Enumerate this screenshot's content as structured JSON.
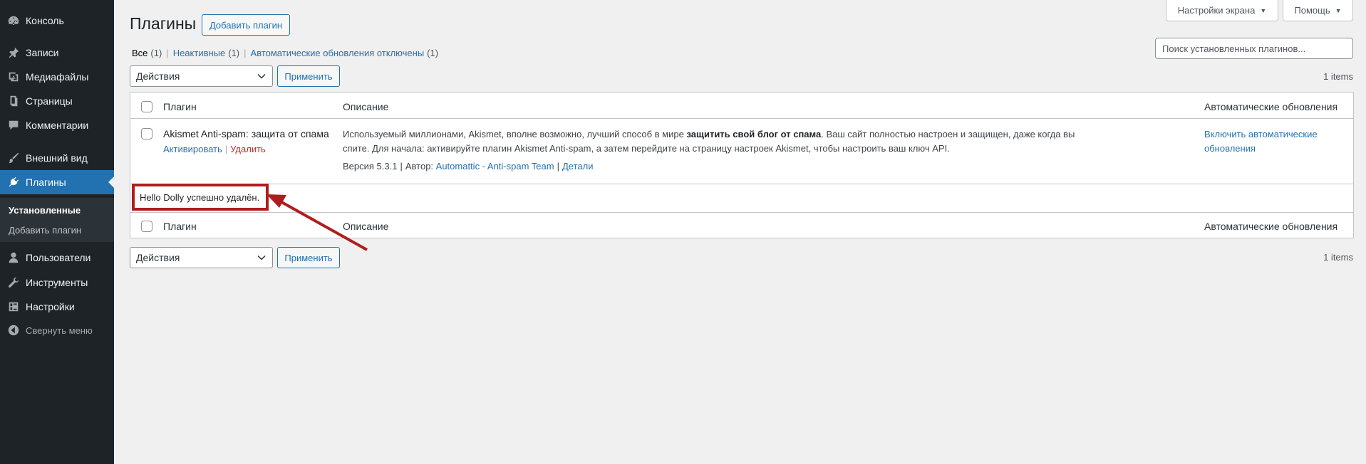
{
  "sidebar": {
    "items": [
      {
        "label": "Консоль",
        "icon": "dashboard-icon"
      },
      {
        "label": "Записи",
        "icon": "pin-icon"
      },
      {
        "label": "Медиафайлы",
        "icon": "media-icon"
      },
      {
        "label": "Страницы",
        "icon": "pages-icon"
      },
      {
        "label": "Комментарии",
        "icon": "comment-icon"
      },
      {
        "label": "Внешний вид",
        "icon": "brush-icon"
      },
      {
        "label": "Плагины",
        "icon": "plugin-icon"
      },
      {
        "label": "Пользователи",
        "icon": "user-icon"
      },
      {
        "label": "Инструменты",
        "icon": "wrench-icon"
      },
      {
        "label": "Настройки",
        "icon": "settings-icon"
      },
      {
        "label": "Свернуть меню",
        "icon": "collapse-icon"
      }
    ],
    "submenu": [
      "Установленные",
      "Добавить плагин"
    ]
  },
  "header": {
    "title": "Плагины",
    "add_button": "Добавить плагин",
    "screen_options": "Настройки экрана",
    "help": "Помощь"
  },
  "filters": {
    "all": "Все",
    "all_count": "(1)",
    "inactive": "Неактивные",
    "inactive_count": "(1)",
    "auto_off": "Автоматические обновления отключены",
    "auto_off_count": "(1)"
  },
  "search": {
    "placeholder": "Поиск установленных плагинов..."
  },
  "bulk": {
    "select": "Действия",
    "apply": "Применить",
    "items": "1 items"
  },
  "table": {
    "headers": [
      "Плагин",
      "Описание",
      "Автоматические обновления"
    ],
    "plugin": {
      "name": "Akismet Anti-spam: защита от спама",
      "activate": "Активировать",
      "delete": "Удалить",
      "desc_pre": "Используемый миллионами, Akismet, вполне возможно, лучший способ в мире ",
      "desc_bold": "защитить свой блог от спама",
      "desc_post": ". Ваш сайт полностью настроен и защищен, даже когда вы спите. Для начала: активируйте плагин Akismet Anti-spam, а затем перейдите на страницу настроек Akismet, чтобы настроить ваш ключ API.",
      "version": "Версия 5.3.1",
      "author_label": "Автор:",
      "author": "Automattic - Anti-spam Team",
      "details": "Детали",
      "auto_update": "Включить автоматические обновления"
    },
    "notice_name": "Hello Dolly",
    "notice_text": "успешно удалён."
  },
  "colors": {
    "accent": "#2271b1",
    "sidebar": "#1d2327",
    "highlight": "#b01c1c",
    "danger": "#b32d2e"
  }
}
